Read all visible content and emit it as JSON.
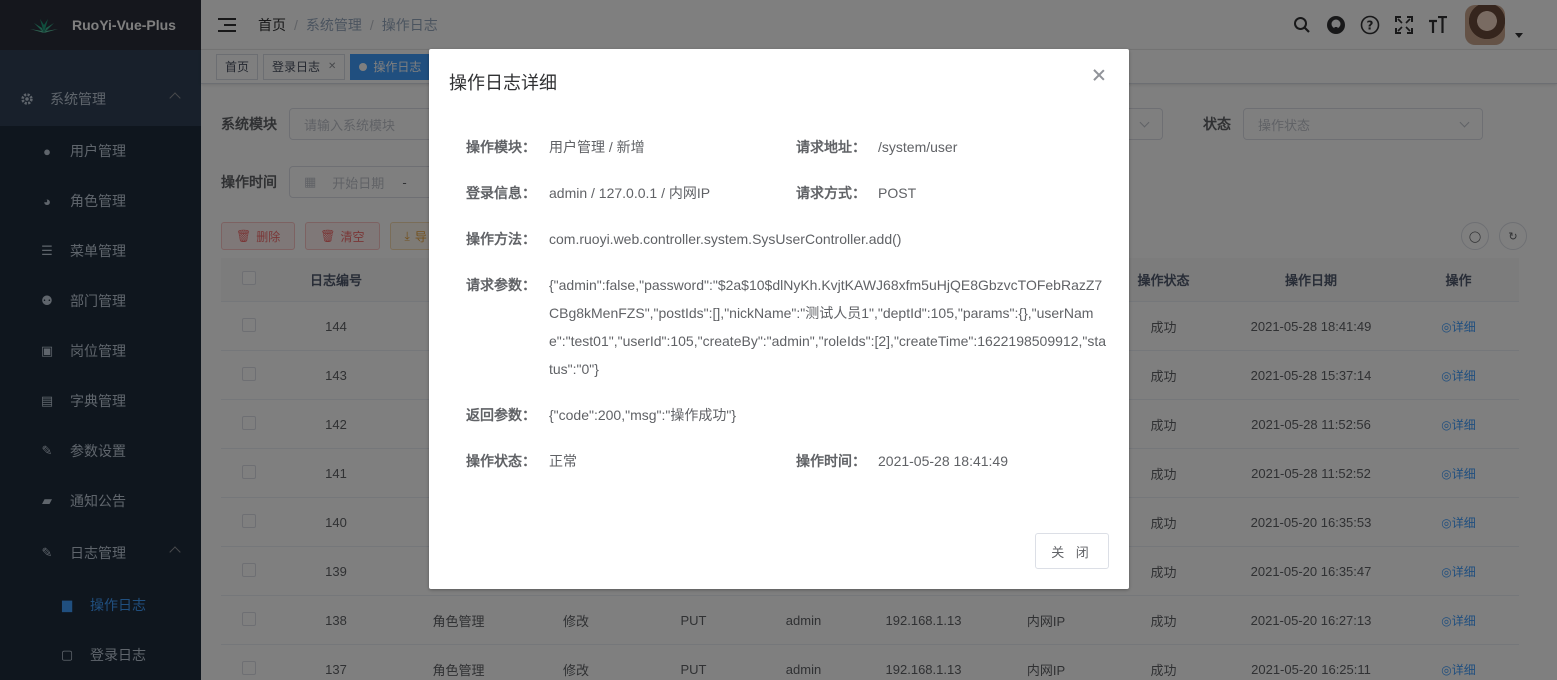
{
  "app": {
    "title": "RuoYi-Vue-Plus"
  },
  "sidebar": {
    "groups": [
      {
        "label": "系统管理"
      },
      {
        "label": "日志管理"
      }
    ],
    "items": [
      {
        "label": "用户管理"
      },
      {
        "label": "角色管理"
      },
      {
        "label": "菜单管理"
      },
      {
        "label": "部门管理"
      },
      {
        "label": "岗位管理"
      },
      {
        "label": "字典管理"
      },
      {
        "label": "参数设置"
      },
      {
        "label": "通知公告"
      }
    ],
    "log_items": [
      {
        "label": "操作日志"
      },
      {
        "label": "登录日志"
      }
    ]
  },
  "breadcrumb": [
    "首页",
    "系统管理",
    "操作日志"
  ],
  "tags": [
    {
      "label": "首页"
    },
    {
      "label": "登录日志"
    },
    {
      "label": "操作日志"
    }
  ],
  "filters": {
    "module_label": "系统模块",
    "module_placeholder": "请输入系统模块",
    "status_label": "状态",
    "status_placeholder": "操作状态",
    "time_label": "操作时间",
    "start_placeholder": "开始日期",
    "dash": "-"
  },
  "toolbar": {
    "delete_label": "删除",
    "clear_label": "清空",
    "export_label": "导"
  },
  "table": {
    "headers": {
      "id": "日志编号",
      "status": "操作状态",
      "date": "操作日期",
      "action": "操作"
    },
    "rows": [
      {
        "id": "144",
        "module": "",
        "type": "",
        "method": "",
        "user": "",
        "ip": "",
        "location": "",
        "status": "成功",
        "date": "2021-05-28 18:41:49",
        "action": "详细"
      },
      {
        "id": "143",
        "module": "",
        "type": "",
        "method": "",
        "user": "",
        "ip": "",
        "location": "",
        "status": "成功",
        "date": "2021-05-28 15:37:14",
        "action": "详细"
      },
      {
        "id": "142",
        "module": "",
        "type": "",
        "method": "",
        "user": "",
        "ip": "",
        "location": "",
        "status": "成功",
        "date": "2021-05-28 11:52:56",
        "action": "详细"
      },
      {
        "id": "141",
        "module": "",
        "type": "",
        "method": "",
        "user": "",
        "ip": "",
        "location": "",
        "status": "成功",
        "date": "2021-05-28 11:52:52",
        "action": "详细"
      },
      {
        "id": "140",
        "module": "",
        "type": "",
        "method": "",
        "user": "",
        "ip": "",
        "location": "",
        "status": "成功",
        "date": "2021-05-20 16:35:53",
        "action": "详细"
      },
      {
        "id": "139",
        "module": "",
        "type": "",
        "method": "",
        "user": "",
        "ip": "",
        "location": "",
        "status": "成功",
        "date": "2021-05-20 16:35:47",
        "action": "详细"
      },
      {
        "id": "138",
        "module": "角色管理",
        "type": "修改",
        "method": "PUT",
        "user": "admin",
        "ip": "192.168.1.13",
        "location": "内网IP",
        "status": "成功",
        "date": "2021-05-20 16:27:13",
        "action": "详细"
      },
      {
        "id": "137",
        "module": "角色管理",
        "type": "修改",
        "method": "PUT",
        "user": "admin",
        "ip": "192.168.1.13",
        "location": "内网IP",
        "status": "成功",
        "date": "2021-05-20 16:25:11",
        "action": "详细"
      }
    ]
  },
  "dialog": {
    "title": "操作日志详细",
    "module_label": "操作模块：",
    "module_value": "用户管理 / 新增",
    "url_label": "请求地址：",
    "url_value": "/system/user",
    "login_label": "登录信息：",
    "login_value": "admin / 127.0.0.1 / 内网IP",
    "method_label": "请求方式：",
    "method_value": "POST",
    "op_method_label": "操作方法：",
    "op_method_value": "com.ruoyi.web.controller.system.SysUserController.add()",
    "params_label": "请求参数：",
    "params_value": "{\"admin\":false,\"password\":\"$2a$10$dlNyKh.KvjtKAWJ68xfm5uHjQE8GbzvcTOFebRazZ7CBg8kMenFZS\",\"postIds\":[],\"nickName\":\"测试人员1\",\"deptId\":105,\"params\":{},\"userName\":\"test01\",\"userId\":105,\"createBy\":\"admin\",\"roleIds\":[2],\"createTime\":1622198509912,\"status\":\"0\"}",
    "result_label": "返回参数：",
    "result_value": "{\"code\":200,\"msg\":\"操作成功\"}",
    "status_label": "操作状态：",
    "status_value": "正常",
    "time_label": "操作时间：",
    "time_value": "2021-05-28 18:41:49",
    "close_label": "关 闭"
  }
}
